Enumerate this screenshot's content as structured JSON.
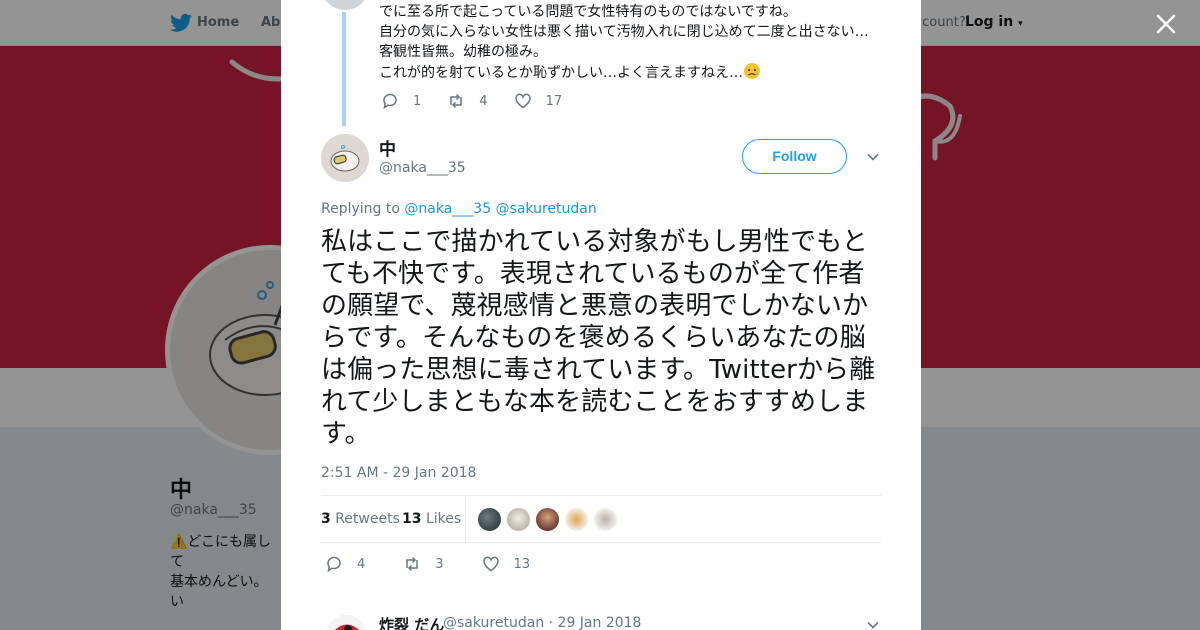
{
  "topbar": {
    "home_label": "Home",
    "about_label": "Abo",
    "account_prompt": "ccount?",
    "login_label": "Log in"
  },
  "profile": {
    "name": "中",
    "handle": "@naka___35",
    "bio": "⚠️どこにも属して\n基本めんどい。 い\nて。また栞代わり\nロバ適当。表現の"
  },
  "previous_tweet": {
    "lines": [
      "でに至る所で起こっている問題で女性特有のものではないですね。",
      "自分の気に入らない女性は悪く描いて汚物入れに閉じ込めて二度と出さない…",
      "客観性皆無。幼稚の極み。",
      "これが的を射ているとか恥ずかしい…よく言えますねえ…"
    ],
    "replies": "1",
    "retweets": "4",
    "likes": "17"
  },
  "tweet": {
    "author_name": "中",
    "author_handle": "@naka___35",
    "follow_label": "Follow",
    "replying_prefix": "Replying to",
    "replying_to": [
      "@naka___35",
      "@sakuretudan"
    ],
    "text": "私はここで描かれている対象がもし男性でもとても不快です。表現されているものが全て作者の願望で、蔑視感情と悪意の表明でしかないからです。そんなものを褒めるくらいあなたの脳は偏った思想に毒されています。Twitterから離れて少しまともな本を読むことをおすすめします。",
    "timestamp": "2:51 AM - 29 Jan 2018",
    "retweet_count": "3",
    "retweet_label": "Retweets",
    "like_count": "13",
    "like_label": "Likes",
    "replies": "4",
    "retweets": "3",
    "likes": "13"
  },
  "next_tweet": {
    "author_name": "炸裂 だん",
    "author_handle": "@sakuretudan",
    "date": "· 29 Jan 2018"
  },
  "colors": {
    "twitter_blue": "#1da1f2",
    "banner_red": "#c8233e",
    "thread_line": "#a3d4f7"
  },
  "icons": [
    "twitter-bird-icon",
    "close-icon",
    "reply-icon",
    "retweet-icon",
    "like-icon",
    "chevron-down-icon"
  ]
}
